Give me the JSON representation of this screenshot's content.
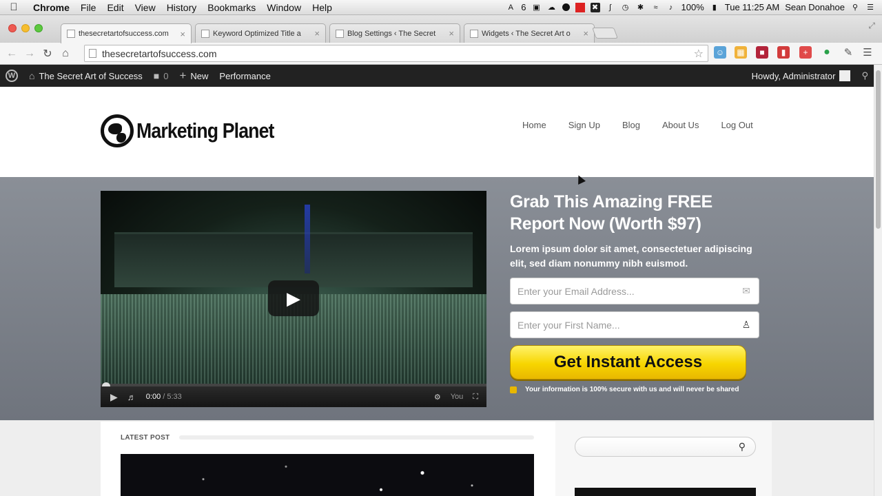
{
  "macos": {
    "app_name": "Chrome",
    "menus": [
      "File",
      "Edit",
      "View",
      "History",
      "Bookmarks",
      "Window",
      "Help"
    ],
    "adobe_badge": "6",
    "battery": "100%",
    "clock": "Tue 11:25 AM",
    "user": "Sean Donahoe"
  },
  "tabs": [
    {
      "title": "thesecretartofsuccess.com",
      "active": true
    },
    {
      "title": "Keyword Optimized Title a",
      "active": false
    },
    {
      "title": "Blog Settings ‹ The Secret",
      "active": false
    },
    {
      "title": "Widgets ‹ The Secret Art o",
      "active": false
    }
  ],
  "omnibox": {
    "url": "thesecretartofsuccess.com"
  },
  "adminbar": {
    "wp_logo": "W",
    "site_name": "The Secret Art of Success",
    "comments_count": "0",
    "new_label": "New",
    "performance_label": "Performance",
    "howdy": "Howdy, Administrator"
  },
  "site": {
    "logo_text": "Marketing Planet",
    "nav": [
      "Home",
      "Sign Up",
      "Blog",
      "About Us",
      "Log Out"
    ]
  },
  "video": {
    "current_time": "0:00",
    "duration": "5:33",
    "youtube_label": "You"
  },
  "optin": {
    "headline": "Grab This Amazing FREE Report Now (Worth $97)",
    "subtext": "Lorem ipsum dolor sit amet, consectetuer adipiscing elit, sed diam nonummy nibh euismod.",
    "email_placeholder": "Enter your Email Address...",
    "name_placeholder": "Enter your First Name...",
    "cta_label": "Get Instant Access",
    "secure_note": "Your information is 100% secure with us and will never be shared"
  },
  "content": {
    "latest_post_label": "LATEST POST"
  },
  "colors": {
    "admin_bar": "#222222",
    "hero_bg": "#7d828a",
    "cta_yellow": "#f7d500"
  }
}
